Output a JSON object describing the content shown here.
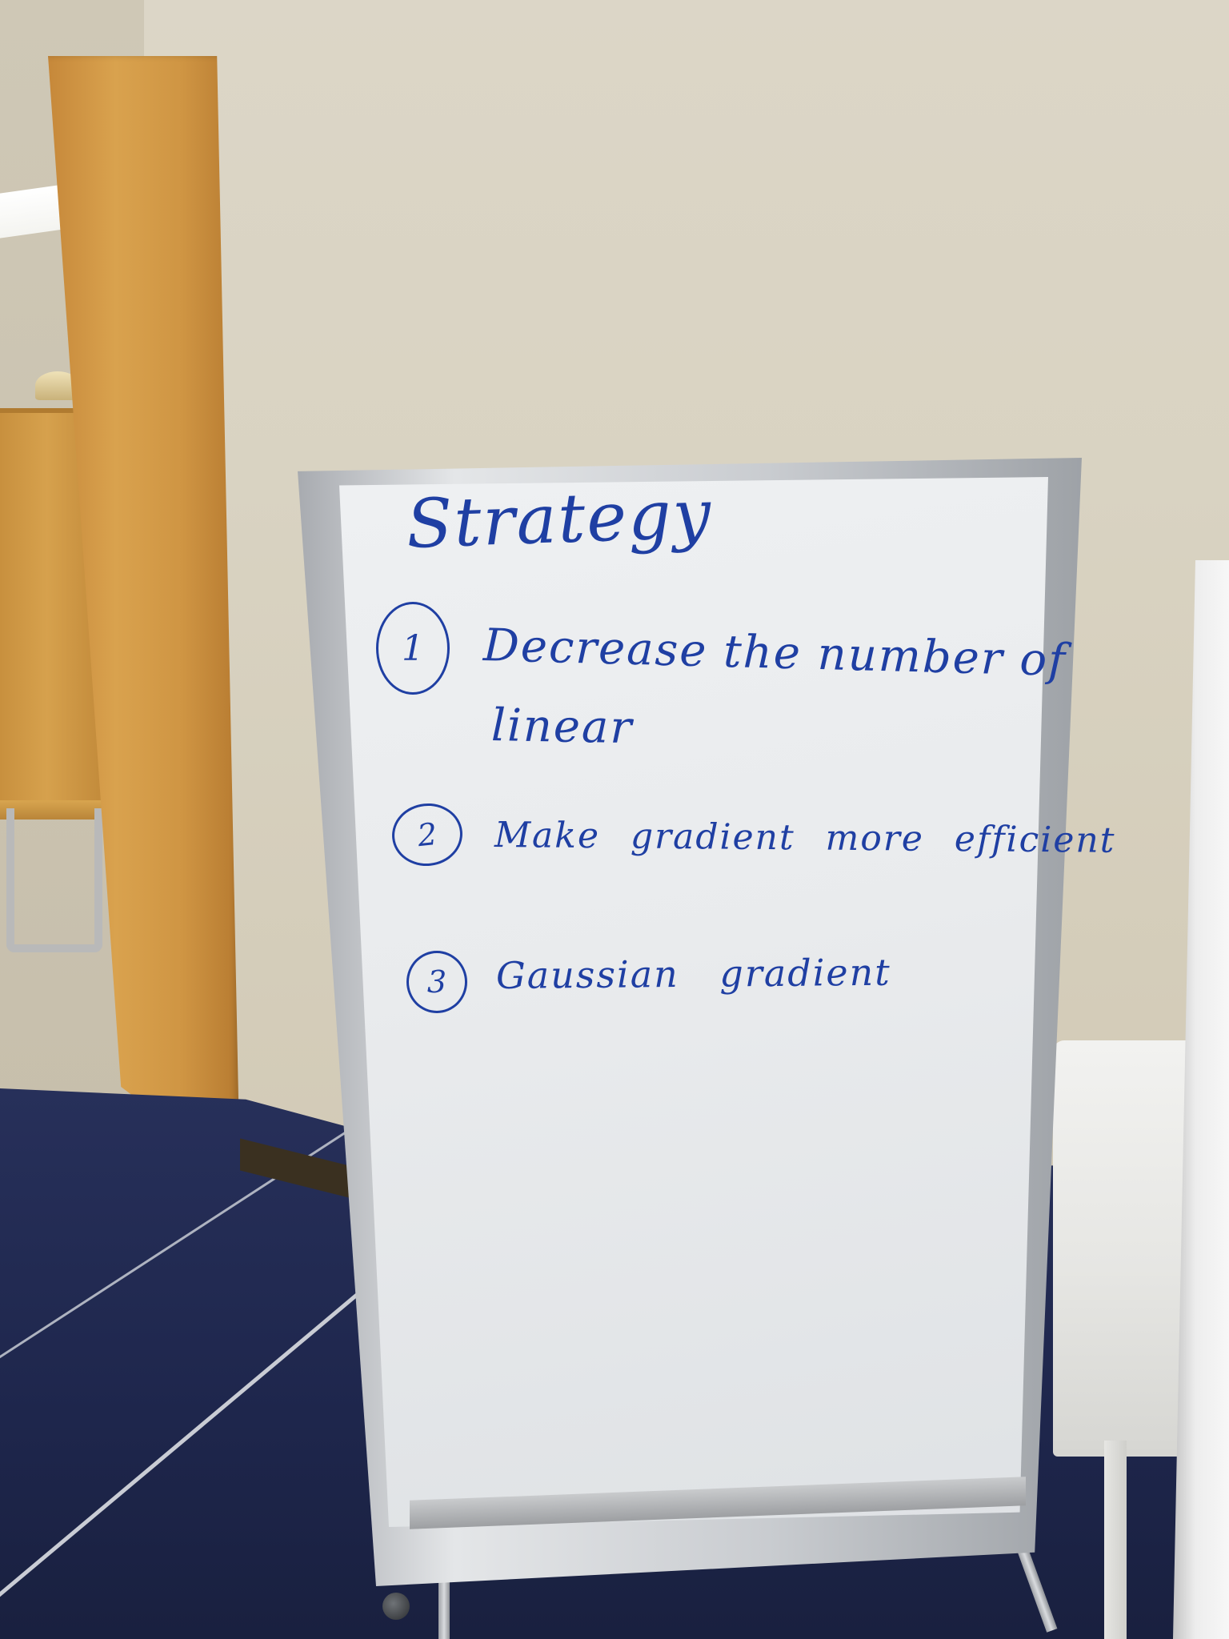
{
  "whiteboard": {
    "title": "Strategy",
    "items": [
      {
        "number": "1",
        "lines": [
          "Decrease the number of",
          "linear"
        ]
      },
      {
        "number": "2",
        "lines": [
          "Make gradient more efficient"
        ]
      },
      {
        "number": "3",
        "lines": [
          "Gaussian gradient"
        ]
      }
    ]
  },
  "colors": {
    "ink": "#1f3fa3",
    "board": "#eceef0",
    "wall": "#d9d3c2",
    "carpet": "#222a52",
    "wood": "#d19a48"
  }
}
